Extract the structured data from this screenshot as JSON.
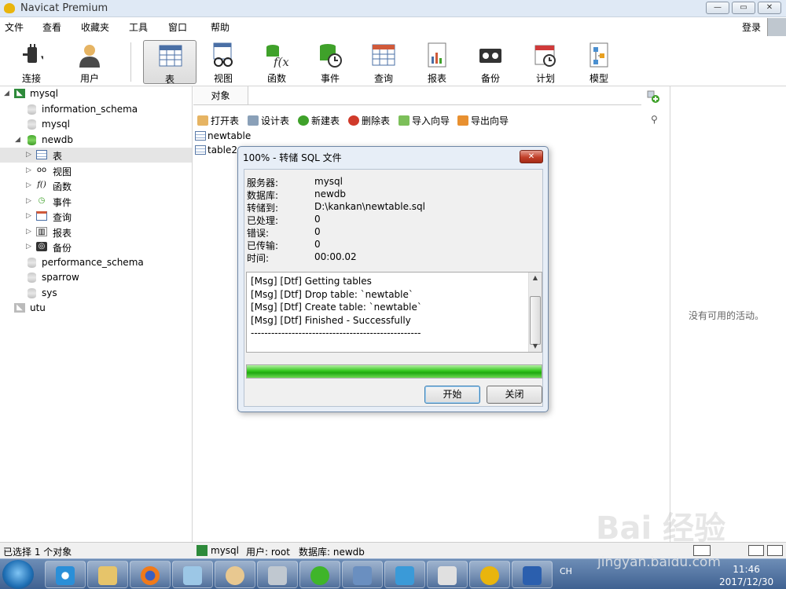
{
  "window": {
    "title": "Navicat Premium",
    "controls": [
      "—",
      "▭",
      "✕"
    ]
  },
  "menu": [
    "文件",
    "查看",
    "收藏夹",
    "工具",
    "窗口",
    "帮助"
  ],
  "login": "登录",
  "toolbar": [
    {
      "label": "连接",
      "icon": "plug-icon"
    },
    {
      "label": "用户",
      "icon": "user-icon"
    },
    {
      "label": "表",
      "icon": "table-icon"
    },
    {
      "label": "视图",
      "icon": "view-glasses-icon"
    },
    {
      "label": "函数",
      "icon": "function-icon"
    },
    {
      "label": "事件",
      "icon": "event-clock-icon"
    },
    {
      "label": "查询",
      "icon": "query-icon"
    },
    {
      "label": "报表",
      "icon": "report-icon"
    },
    {
      "label": "备份",
      "icon": "backup-tape-icon"
    },
    {
      "label": "计划",
      "icon": "calendar-icon"
    },
    {
      "label": "模型",
      "icon": "model-icon"
    }
  ],
  "tree": {
    "conn1": "mysql",
    "db_information_schema": "information_schema",
    "db_mysql": "mysql",
    "db_newdb": "newdb",
    "node_table": "表",
    "node_view": "视图",
    "node_func": "函数",
    "node_event": "事件",
    "node_query": "查询",
    "node_report": "报表",
    "node_backup": "备份",
    "db_performance": "performance_schema",
    "db_sparrow": "sparrow",
    "db_sys": "sys",
    "conn2": "utu"
  },
  "objects_tab": "对象",
  "actions": [
    "打开表",
    "设计表",
    "新建表",
    "删除表",
    "导入向导",
    "导出向导"
  ],
  "tables": [
    "newtable",
    "table2"
  ],
  "right_panel": "没有可用的活动。",
  "dialog": {
    "title": "100% - 转储 SQL 文件",
    "fields": [
      {
        "k": "服务器:",
        "v": "mysql"
      },
      {
        "k": "数据库:",
        "v": "newdb"
      },
      {
        "k": "转储到:",
        "v": "D:\\kankan\\newtable.sql"
      },
      {
        "k": "已处理:",
        "v": "0"
      },
      {
        "k": "错误:",
        "v": "0"
      },
      {
        "k": "已传输:",
        "v": "0"
      },
      {
        "k": "时间:",
        "v": "00:00.02"
      }
    ],
    "log": [
      "[Msg] [Dtf] Getting tables",
      "[Msg] [Dtf] Drop table: `newtable`",
      "[Msg] [Dtf] Create table: `newtable`",
      "[Msg] [Dtf] Finished - Successfully",
      "--------------------------------------------------"
    ],
    "progress": 1.0,
    "btn_start": "开始",
    "btn_close": "关闭"
  },
  "status": {
    "selected": "已选择 1 个对象",
    "conn": "mysql",
    "user": "用户: root",
    "db": "数据库: newdb"
  },
  "taskbar": {
    "tray": "CH",
    "time": "11:46",
    "date": "2017/12/30"
  },
  "watermark": {
    "brand": "Bai 经验",
    "url": "jingyan.baidu.com"
  }
}
